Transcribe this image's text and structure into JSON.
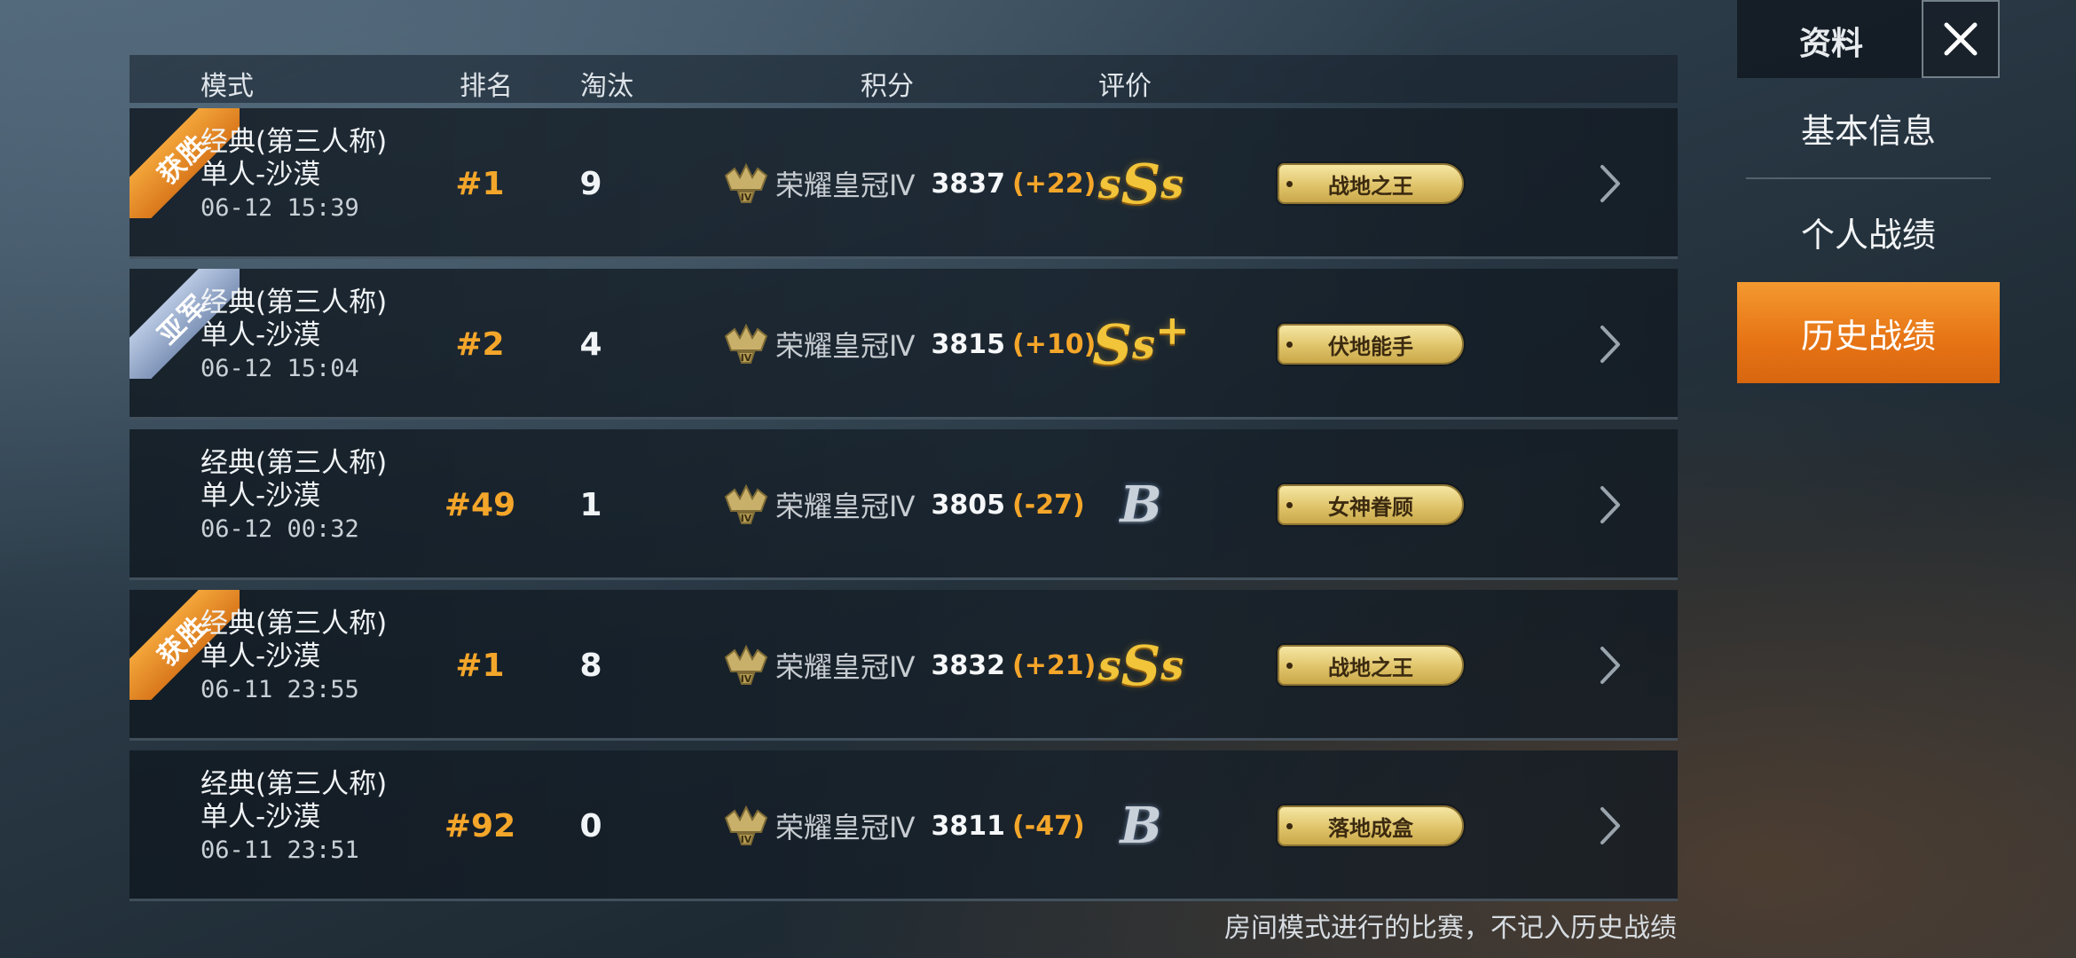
{
  "table": {
    "headers": {
      "mode": "模式",
      "rank": "排名",
      "kills": "淘汰",
      "points": "积分",
      "rating": "评价"
    },
    "rows": [
      {
        "ribbon": "获胜",
        "ribbon_style": "gold",
        "mode_line1": "经典(第三人称)",
        "mode_line2": "单人-沙漠",
        "timestamp": "06-12 15:39",
        "rank": "#1",
        "kills": "9",
        "tier": "荣耀皇冠Ⅳ",
        "score": "3837",
        "delta": "(+22)",
        "grade_parts": [
          "s",
          "S",
          "s"
        ],
        "grade_style": "gold",
        "grade_plus": "",
        "badge": "战地之王"
      },
      {
        "ribbon": "亚军",
        "ribbon_style": "silver",
        "mode_line1": "经典(第三人称)",
        "mode_line2": "单人-沙漠",
        "timestamp": "06-12 15:04",
        "rank": "#2",
        "kills": "4",
        "tier": "荣耀皇冠Ⅳ",
        "score": "3815",
        "delta": "(+10)",
        "grade_parts": [
          "S",
          "s"
        ],
        "grade_style": "gold",
        "grade_plus": "+",
        "badge": "伏地能手"
      },
      {
        "ribbon": "",
        "ribbon_style": "",
        "mode_line1": "经典(第三人称)",
        "mode_line2": "单人-沙漠",
        "timestamp": "06-12 00:32",
        "rank": "#49",
        "kills": "1",
        "tier": "荣耀皇冠Ⅳ",
        "score": "3805",
        "delta": "(-27)",
        "grade_parts": [
          "B"
        ],
        "grade_style": "silver",
        "grade_plus": "",
        "badge": "女神眷顾"
      },
      {
        "ribbon": "获胜",
        "ribbon_style": "gold",
        "mode_line1": "经典(第三人称)",
        "mode_line2": "单人-沙漠",
        "timestamp": "06-11 23:55",
        "rank": "#1",
        "kills": "8",
        "tier": "荣耀皇冠Ⅳ",
        "score": "3832",
        "delta": "(+21)",
        "grade_parts": [
          "s",
          "S",
          "s"
        ],
        "grade_style": "gold",
        "grade_plus": "",
        "badge": "战地之王"
      },
      {
        "ribbon": "",
        "ribbon_style": "",
        "mode_line1": "经典(第三人称)",
        "mode_line2": "单人-沙漠",
        "timestamp": "06-11 23:51",
        "rank": "#92",
        "kills": "0",
        "tier": "荣耀皇冠Ⅳ",
        "score": "3811",
        "delta": "(-47)",
        "grade_parts": [
          "B"
        ],
        "grade_style": "silver",
        "grade_plus": "",
        "badge": "落地成盒"
      }
    ],
    "footer_note": "房间模式进行的比赛，不记入历史战绩"
  },
  "side_panel": {
    "title": "资料",
    "close_icon": "close-icon",
    "menu": [
      {
        "label": "基本信息",
        "active": false
      },
      {
        "label": "个人战绩",
        "active": false
      },
      {
        "label": "历史战绩",
        "active": true
      }
    ]
  },
  "colors": {
    "accent_orange": "#f4a62a",
    "active_tab": "#e67314",
    "badge_gold": "#e0c46a"
  }
}
